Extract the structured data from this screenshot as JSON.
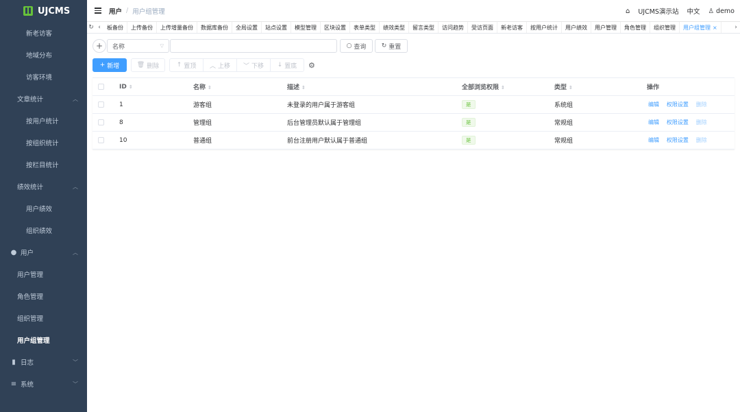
{
  "brand": {
    "name": "UJCMS"
  },
  "sidebar": {
    "items": [
      {
        "label": "新老访客",
        "kind": "sub"
      },
      {
        "label": "地域分布",
        "kind": "sub"
      },
      {
        "label": "访客环境",
        "kind": "sub"
      },
      {
        "label": "文章统计",
        "kind": "group"
      },
      {
        "label": "按用户统计",
        "kind": "sub"
      },
      {
        "label": "按组织统计",
        "kind": "sub"
      },
      {
        "label": "按栏目统计",
        "kind": "sub"
      },
      {
        "label": "绩效统计",
        "kind": "group"
      },
      {
        "label": "用户绩效",
        "kind": "sub"
      },
      {
        "label": "组织绩效",
        "kind": "sub"
      },
      {
        "label": "用户",
        "kind": "top"
      },
      {
        "label": "用户管理",
        "kind": "group"
      },
      {
        "label": "角色管理",
        "kind": "group"
      },
      {
        "label": "组织管理",
        "kind": "group"
      },
      {
        "label": "用户组管理",
        "kind": "group"
      },
      {
        "label": "日志",
        "kind": "top"
      },
      {
        "label": "系统",
        "kind": "top"
      }
    ]
  },
  "header": {
    "breadcrumb_main": "用户",
    "breadcrumb_sep": "/",
    "breadcrumb_current": "用户组管理",
    "site_name": "UJCMS演示站",
    "language": "中文",
    "username": "demo"
  },
  "tabs": [
    "板备份",
    "上传备份",
    "上传增量备份",
    "数据库备份",
    "全局设置",
    "站点设置",
    "模型管理",
    "区块设置",
    "表单类型",
    "绩效类型",
    "留言类型",
    "访问趋势",
    "受访页面",
    "新老访客",
    "按用户统计",
    "用户绩效",
    "用户管理",
    "角色管理",
    "组织管理",
    "用户组管理"
  ],
  "search": {
    "field_select": "名称",
    "query_label": "查询",
    "reset_label": "重置"
  },
  "toolbar": {
    "add_label": "新增",
    "delete_label": "删除",
    "top_label": "置顶",
    "up_label": "上移",
    "down_label": "下移",
    "bottom_label": "置底"
  },
  "table": {
    "headers": {
      "id": "ID",
      "name": "名称",
      "desc": "描述",
      "perm": "全部浏览权限",
      "type": "类型",
      "ops": "操作"
    },
    "rows": [
      {
        "id": "1",
        "name": "游客组",
        "desc": "未登录的用户属于游客组",
        "perm": "是",
        "type": "系统组"
      },
      {
        "id": "8",
        "name": "管理组",
        "desc": "后台管理员默认属于管理组",
        "perm": "是",
        "type": "常规组"
      },
      {
        "id": "10",
        "name": "普通组",
        "desc": "前台注册用户默认属于普通组",
        "perm": "是",
        "type": "常规组"
      }
    ],
    "ops": {
      "edit": "编辑",
      "permission": "权限设置",
      "delete": "删除"
    }
  },
  "colors": {
    "sidebar_bg": "#304156",
    "primary": "#409eff",
    "success": "#67c23a"
  }
}
